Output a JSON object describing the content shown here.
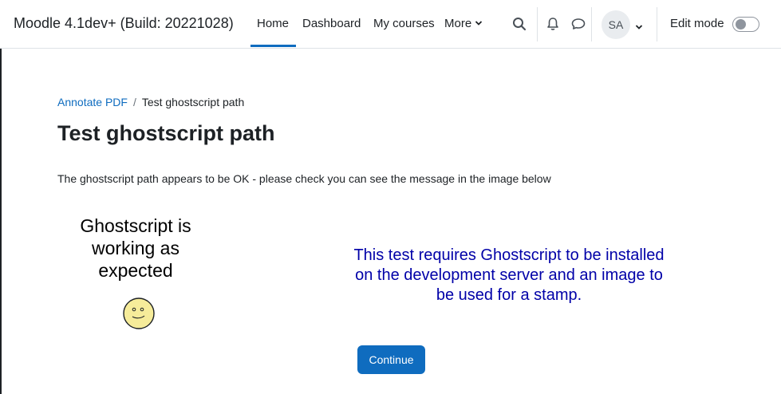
{
  "header": {
    "site_name": "Moodle 4.1dev+ (Build: 20221028)",
    "nav": [
      {
        "label": "Home",
        "active": true
      },
      {
        "label": "Dashboard"
      },
      {
        "label": "My courses"
      },
      {
        "label": "More"
      }
    ],
    "icons": [
      "search-icon",
      "bell-icon",
      "chat-icon",
      "chevron-down-icon"
    ],
    "user_initials": "SA",
    "edit_mode_label": "Edit mode",
    "edit_mode_on": false,
    "accent_color": "#0f6cbf"
  },
  "breadcrumb": {
    "parent": "Annotate PDF",
    "separator": "/",
    "current": "Test ghostscript path"
  },
  "main": {
    "title": "Test ghostscript path",
    "message": "The ghostscript path appears to be OK - please check you can see the message in the image below",
    "test_image": {
      "left_lines": [
        "Ghostscript is",
        "working as",
        "expected"
      ],
      "right_lines": [
        "This test requires Ghostscript to be installed",
        "on the development server and an image to",
        "be used for a stamp."
      ],
      "right_text_color": "#0000a8"
    },
    "continue_label": "Continue"
  }
}
